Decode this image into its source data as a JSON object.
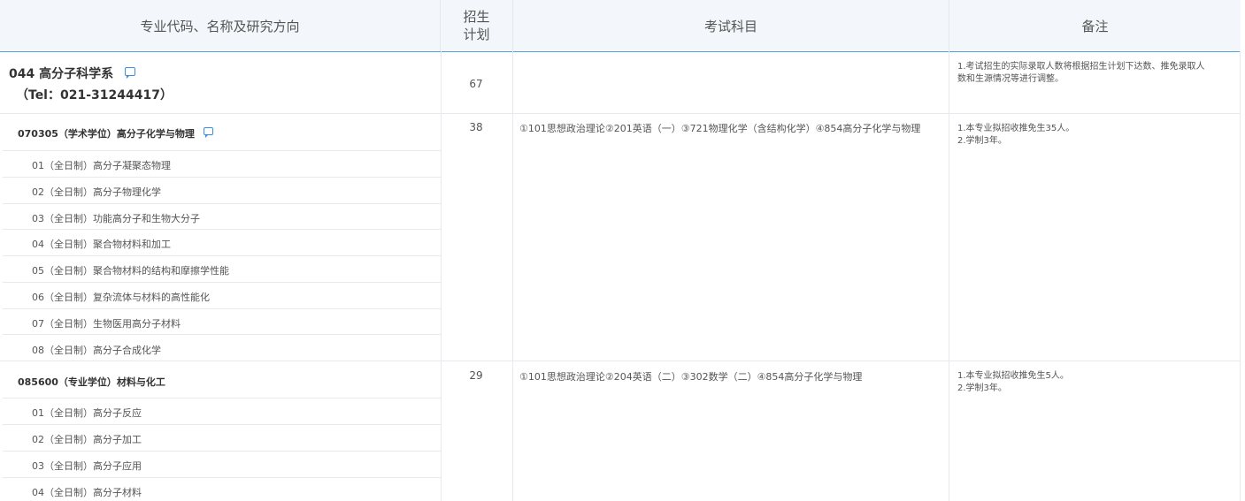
{
  "header": {
    "col_major": "专业代码、名称及研究方向",
    "col_quota_line1": "招生",
    "col_quota_line2": "计划",
    "col_exam": "考试科目",
    "col_notes": "备注"
  },
  "department": {
    "name": "044 高分子科学系",
    "tel": "（Tel：021-31244417）",
    "quota": "67",
    "notes": [
      "1.考试招生的实际录取人数将根据招生计划下达数、推免录取人",
      "数和生源情况等进行调整。"
    ]
  },
  "majors": [
    {
      "title": "070305（学术学位）高分子化学与物理",
      "quota": "38",
      "exam": "①101思想政治理论②201英语（一）③721物理化学（含结构化学）④854高分子化学与物理",
      "notes": [
        "1.本专业拟招收推免生35人。",
        "2.学制3年。"
      ],
      "directions": [
        "01（全日制）高分子凝聚态物理",
        "02（全日制）高分子物理化学",
        "03（全日制）功能高分子和生物大分子",
        "04（全日制）聚合物材料和加工",
        "05（全日制）聚合物材料的结构和摩擦学性能",
        "06（全日制）复杂流体与材料的高性能化",
        "07（全日制）生物医用高分子材料",
        "08（全日制）高分子合成化学"
      ]
    },
    {
      "title": "085600（专业学位）材料与化工",
      "quota": "29",
      "exam": "①101思想政治理论②204英语（二）③302数学（二）④854高分子化学与物理",
      "notes": [
        "1.本专业拟招收推免生5人。",
        "2.学制3年。"
      ],
      "directions": [
        "01（全日制）高分子反应",
        "02（全日制）高分子加工",
        "03（全日制）高分子应用",
        "04（全日制）高分子材料"
      ]
    }
  ]
}
